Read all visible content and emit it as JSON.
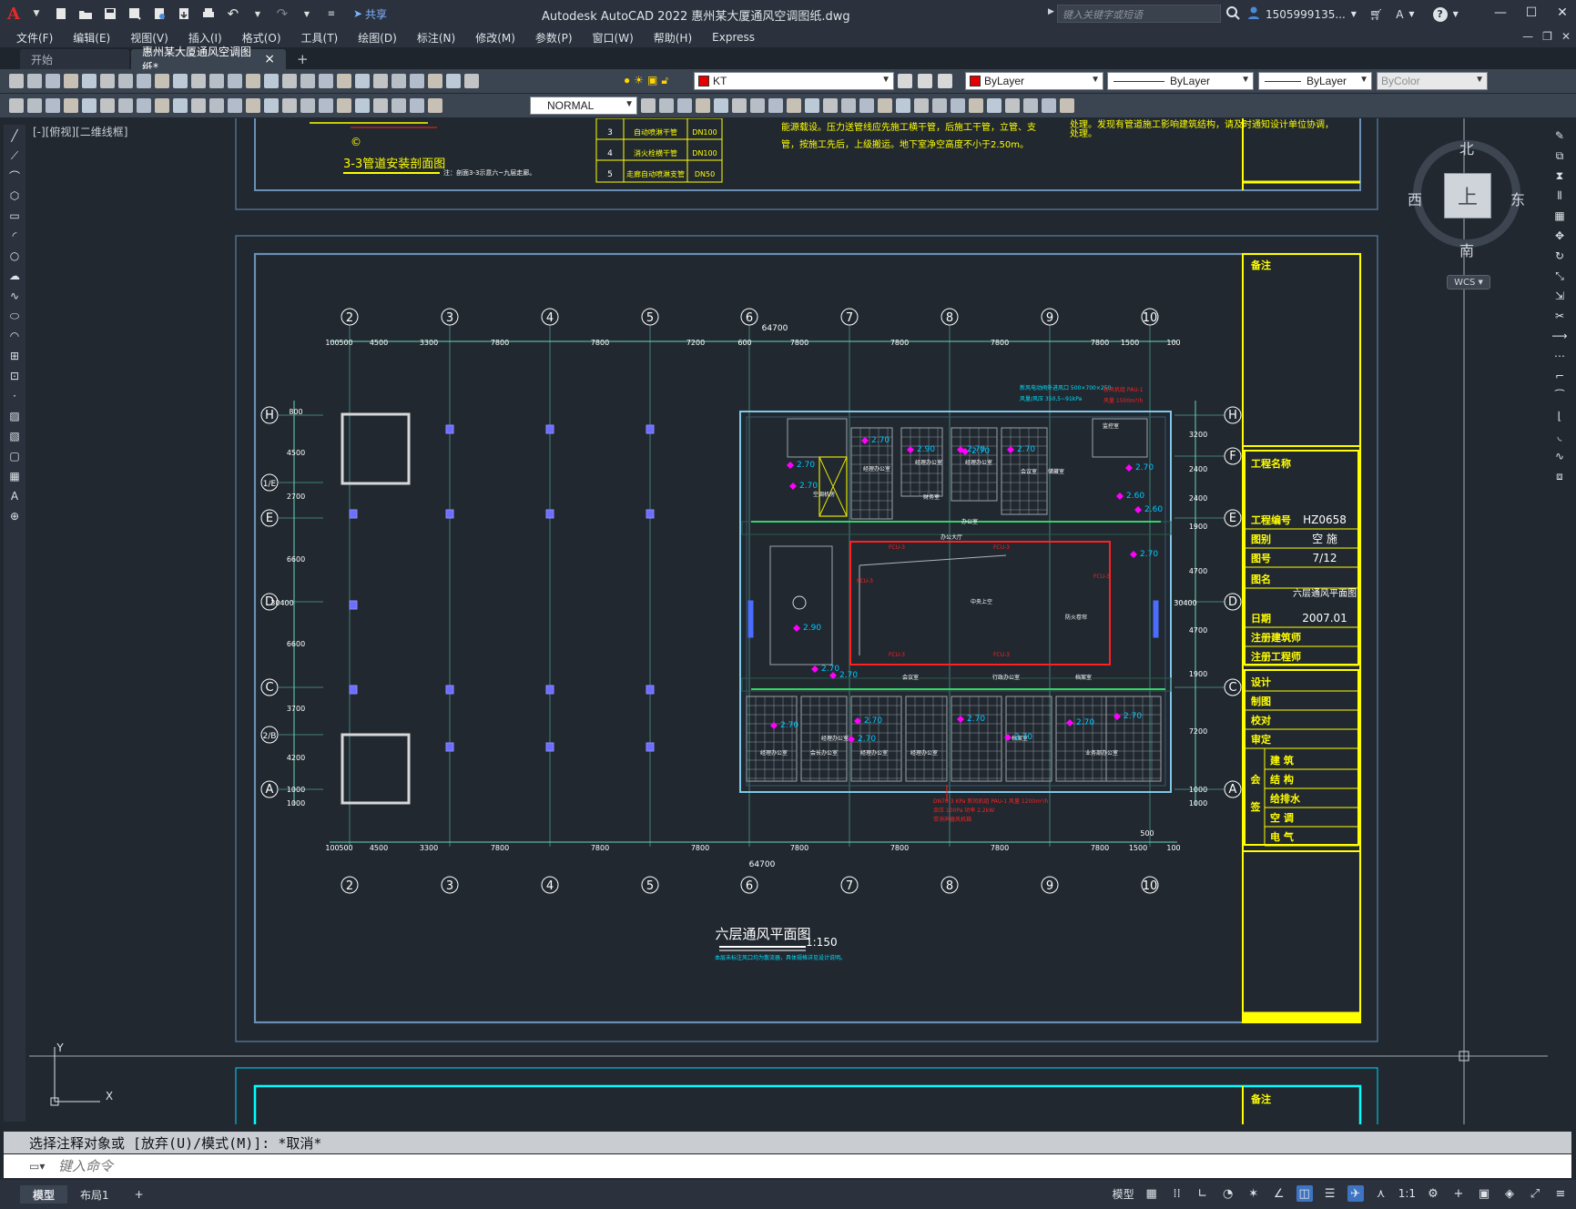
{
  "app": {
    "logo": "A",
    "title": "Autodesk AutoCAD 2022    惠州某大厦通风空调图纸.dwg",
    "share": "共享",
    "search_placeholder": "键入关键字或短语",
    "user": "1505999135...",
    "accent": "#e52a2a"
  },
  "menu": [
    "文件(F)",
    "编辑(E)",
    "视图(V)",
    "插入(I)",
    "格式(O)",
    "工具(T)",
    "绘图(D)",
    "标注(N)",
    "修改(M)",
    "参数(P)",
    "窗口(W)",
    "帮助(H)",
    "Express"
  ],
  "tabs": {
    "start": "开始",
    "drawing": "惠州某大厦通风空调图纸*",
    "close": "×",
    "add": "+"
  },
  "toolbar": {
    "layer": "KT",
    "layer_color": "#e50000",
    "color": "ByLayer",
    "linetype": "ByLayer",
    "lineweight": "ByLayer",
    "plotstyle": "ByColor",
    "textstyle": "NORMAL"
  },
  "viewport": {
    "label": "[-][俯视][二维线框]",
    "wcs": "WCS",
    "compass": {
      "n": "北",
      "s": "南",
      "e": "东",
      "w": "西",
      "top": "上"
    }
  },
  "drawing": {
    "plan_title": "六层通风平面图",
    "plan_scale": "1:150",
    "plan_note": "本层未标注风口均为散流器，具体规格详见设计说明。",
    "section_title": "3-3管道安装剖面图",
    "section_note": "注：剖面3-3示意六~九层走廊。",
    "section_symbol": "©",
    "top_note_1": "能源载设。压力送管线应先施工横干管，后施工干管，立管、支",
    "top_note_2": "管，按施工先后，上级搬运。地下室净空高度不小于2.50m。",
    "top_note_3": "处理。发现有管道施工影响建筑结构，请及时通知设计单位协调，",
    "top_note_4": "处理。",
    "pipe_table": [
      {
        "no": "3",
        "name": "自动喷淋干管",
        "size": "DN100"
      },
      {
        "no": "4",
        "name": "消火栓横干管",
        "size": "DN100"
      },
      {
        "no": "5",
        "name": "走廊自动喷淋支管",
        "size": "DN50"
      }
    ],
    "grid_cols": [
      "2",
      "3",
      "4",
      "5",
      "6",
      "7",
      "8",
      "9",
      "10"
    ],
    "grid_rows": [
      "H",
      "1/E",
      "E",
      "D",
      "C",
      "2/B",
      "A"
    ],
    "right_rows": [
      "H",
      "F",
      "E",
      "D",
      "C",
      "A"
    ],
    "dims_top": [
      "100",
      "500",
      "4500",
      "3300",
      "7800",
      "7800",
      "7200",
      "600",
      "7800",
      "7800",
      "7800",
      "7800",
      "1500",
      "100"
    ],
    "dims_bottom": [
      "100",
      "500",
      "4500",
      "3300",
      "7800",
      "7800",
      "7800",
      "7800",
      "7800",
      "7800",
      "7800",
      "1500",
      "100"
    ],
    "total_width": "64700",
    "total_height": "30400",
    "bottom_extra": "500",
    "left_dims": [
      "800",
      "4500",
      "2700",
      "6600",
      "6600",
      "3700",
      "4200",
      "1000",
      "1000"
    ],
    "right_dims": [
      "3200",
      "2400",
      "2400",
      "1900",
      "4700",
      "4700",
      "1900",
      "7200",
      "1000",
      "1000"
    ],
    "room_labels": [
      "经理办公室",
      "经理办公室",
      "经理办公室",
      "财务室",
      "会议室",
      "储藏室",
      "监控室",
      "空调机房",
      "办公大厅",
      "办公室",
      "中央上空",
      "防火卷帘",
      "行政办公室",
      "会议室",
      "档案室",
      "经理办公室",
      "经理办公室",
      "会长办公室",
      "经理办公室",
      "经理办公室",
      "档案室",
      "业务部办公室"
    ],
    "elevations": [
      "2.70",
      "2.90",
      "2.70",
      "2.70",
      "2.70",
      "2.70",
      "2.70",
      "2.70",
      "2.70",
      "2.60",
      "2.60",
      "2.70",
      "2.90",
      "2.70",
      "2.70",
      "2.70",
      "2.70",
      "2.70",
      "2.70",
      "2.70",
      "2.70"
    ],
    "duct_notes": [
      "新风电动阀外进风口 500×700×250",
      "风量/风压 350,5~91kPa",
      "新风机组 PAU-1",
      "风量 1500m³/h"
    ],
    "fcu": [
      "FCU-3",
      "FCU-3",
      "FCU-3",
      "FCU-3",
      "FCU-3",
      "FCU-3"
    ],
    "red_notes": [
      "DN70-3 KPa 新风机组 PAU-1 风量 1200m³/h",
      "余压 100Pa 功率 2.2kW",
      "带消声器风机箱"
    ],
    "title_block": {
      "remarks": "备注",
      "project": "工程名称",
      "project_no_label": "工程编号",
      "project_no": "HZ0658",
      "discipline_label": "图别",
      "discipline": "空 施",
      "sheet_label": "图号",
      "sheet": "7/12",
      "drawing_name_label": "图名",
      "drawing_name": "六层通风平面图",
      "date_label": "日期",
      "date": "2007.01",
      "architect": "注册建筑师",
      "engineer": "注册工程师",
      "design": "设计",
      "draw": "制图",
      "check": "校对",
      "approve": "审定",
      "sign_label": "会 签",
      "sign_items": [
        "建 筑",
        "结 构",
        "给排水",
        "空 调",
        "电 气"
      ]
    },
    "next_remarks": "备注"
  },
  "command": {
    "history": "选择注释对象或 [放弃(U)/模式(M)]: *取消*",
    "placeholder": "键入命令"
  },
  "status": {
    "model_tab": "模型",
    "layout_tab": "布局1",
    "add": "+",
    "model_label": "模型",
    "scale": "1:1"
  },
  "colors": {
    "yellow": "#ffff00",
    "cyan": "#00ffff",
    "frame": "#6b8fb5",
    "grid": "#67d6bd",
    "red": "#ff2020",
    "magenta": "#ff00ff"
  }
}
